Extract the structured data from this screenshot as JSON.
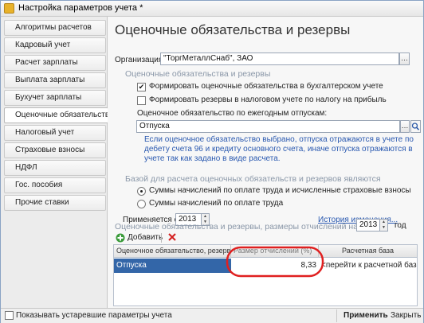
{
  "window": {
    "title": "Настройка параметров учета *"
  },
  "sidebar": {
    "items": [
      {
        "label": "Алгоритмы расчетов"
      },
      {
        "label": "Кадровый учет"
      },
      {
        "label": "Расчет зарплаты"
      },
      {
        "label": "Выплата зарплаты"
      },
      {
        "label": "Бухучет зарплаты"
      },
      {
        "label": "Оценочные обязательства",
        "active": true
      },
      {
        "label": "Налоговый учет"
      },
      {
        "label": "Страховые взносы"
      },
      {
        "label": "НДФЛ"
      },
      {
        "label": "Гос. пособия"
      },
      {
        "label": "Прочие ставки"
      }
    ]
  },
  "main": {
    "title": "Оценочные обязательства и резервы",
    "organization_label": "Организация:",
    "organization_value": "\"ТоргМеталлСнаб\", ЗАО",
    "section1": "Оценочные обязательства и резервы",
    "checkbox_accounting": {
      "label": "Формировать оценочные обязательства в бухгалтерском учете",
      "checked": true
    },
    "checkbox_tax": {
      "label": "Формировать резервы в налоговом учете по налогу на прибыль",
      "checked": false
    },
    "vacation_label": "Оценочное обязательство по ежегодным отпускам:",
    "vacation_value": "Отпуска",
    "note": "Если оценочное обязательство выбрано, отпуска отражаются в учете по дебету счета 96 и кредиту основного счета, иначе отпуска отражаются в учете так как задано в виде расчета.",
    "section2": "Базой для расчета оценочных обязательств и резервов являются",
    "radio_option1": "Суммы начислений по оплате труда и исчисленные страховые взносы",
    "radio_option2": "Суммы начислений по оплате труда",
    "applied_label": "Применяется с:",
    "applied_year": "2013",
    "history_link": "История изменения...",
    "section3": "Оценочные обязательства и резервы, размеры отчислений на:",
    "section3_year": "2013",
    "year_unit": "год",
    "add_button": "Добавить",
    "table": {
      "headers": [
        "Оценочное обязательство, резерв",
        "Размер отчислений (%)",
        "Расчетная база"
      ],
      "rows": [
        {
          "name": "Отпуска",
          "rate": "8,33",
          "base": "<перейти к расчетной базе>"
        }
      ]
    }
  },
  "bottom": {
    "show_obsolete_label": "Показывать устаревшие параметры учета",
    "apply_button": "Применить",
    "close_button": "Закрыть"
  },
  "colors": {
    "accent_blue": "#2a59b0",
    "selection": "#3366a8",
    "highlight_circle": "#e02020"
  }
}
